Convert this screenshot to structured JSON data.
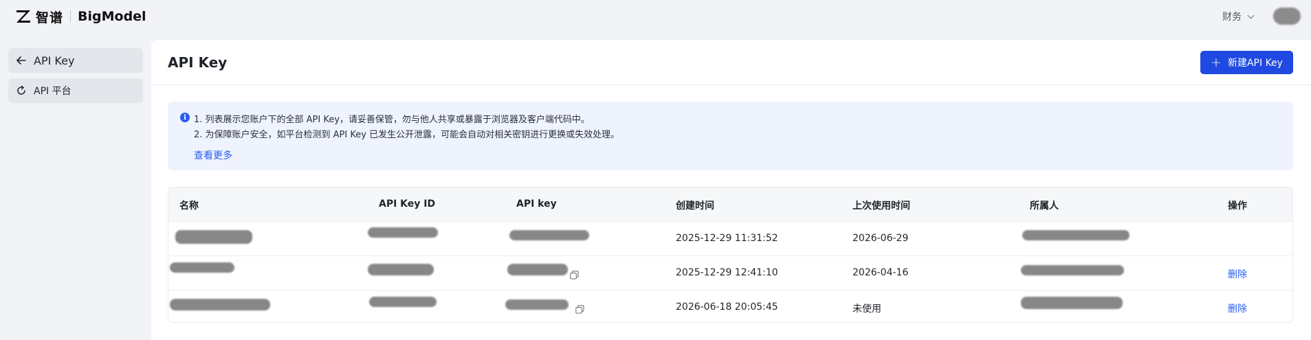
{
  "brand": {
    "cn": "智谱",
    "en": "BigModel"
  },
  "topbar": {
    "finance_label": "财务"
  },
  "sidebar": {
    "items": [
      {
        "label": "API Key",
        "icon": "arrow-left-icon"
      },
      {
        "label": "API 平台",
        "icon": "refresh-icon"
      }
    ]
  },
  "page": {
    "title": "API Key",
    "new_button_label": "新建API Key"
  },
  "notice": {
    "line1": "1. 列表展示您账户下的全部 API Key，请妥善保管，勿与他人共享或暴露于浏览器及客户端代码中。",
    "line2": "2. 为保障账户安全，如平台检测到 API Key 已发生公开泄露，可能会自动对相关密钥进行更换或失效处理。",
    "more_link": "查看更多"
  },
  "table": {
    "headers": [
      "名称",
      "API Key ID",
      "API key",
      "创建时间",
      "上次使用时间",
      "所属人",
      "操作"
    ],
    "rows": [
      {
        "created": "2025-12-29 11:31:52",
        "last_used": "2026-06-29",
        "action": ""
      },
      {
        "created": "2025-12-29 12:41:10",
        "last_used": "2026-04-16",
        "action": "删除"
      },
      {
        "created": "2026-06-18 20:05:45",
        "last_used": "未使用",
        "action": "删除"
      }
    ]
  },
  "colors": {
    "primary": "#1f49e0",
    "link": "#2a5cf0",
    "notice_bg": "#eef3fe",
    "page_bg": "#f1f3f6"
  }
}
